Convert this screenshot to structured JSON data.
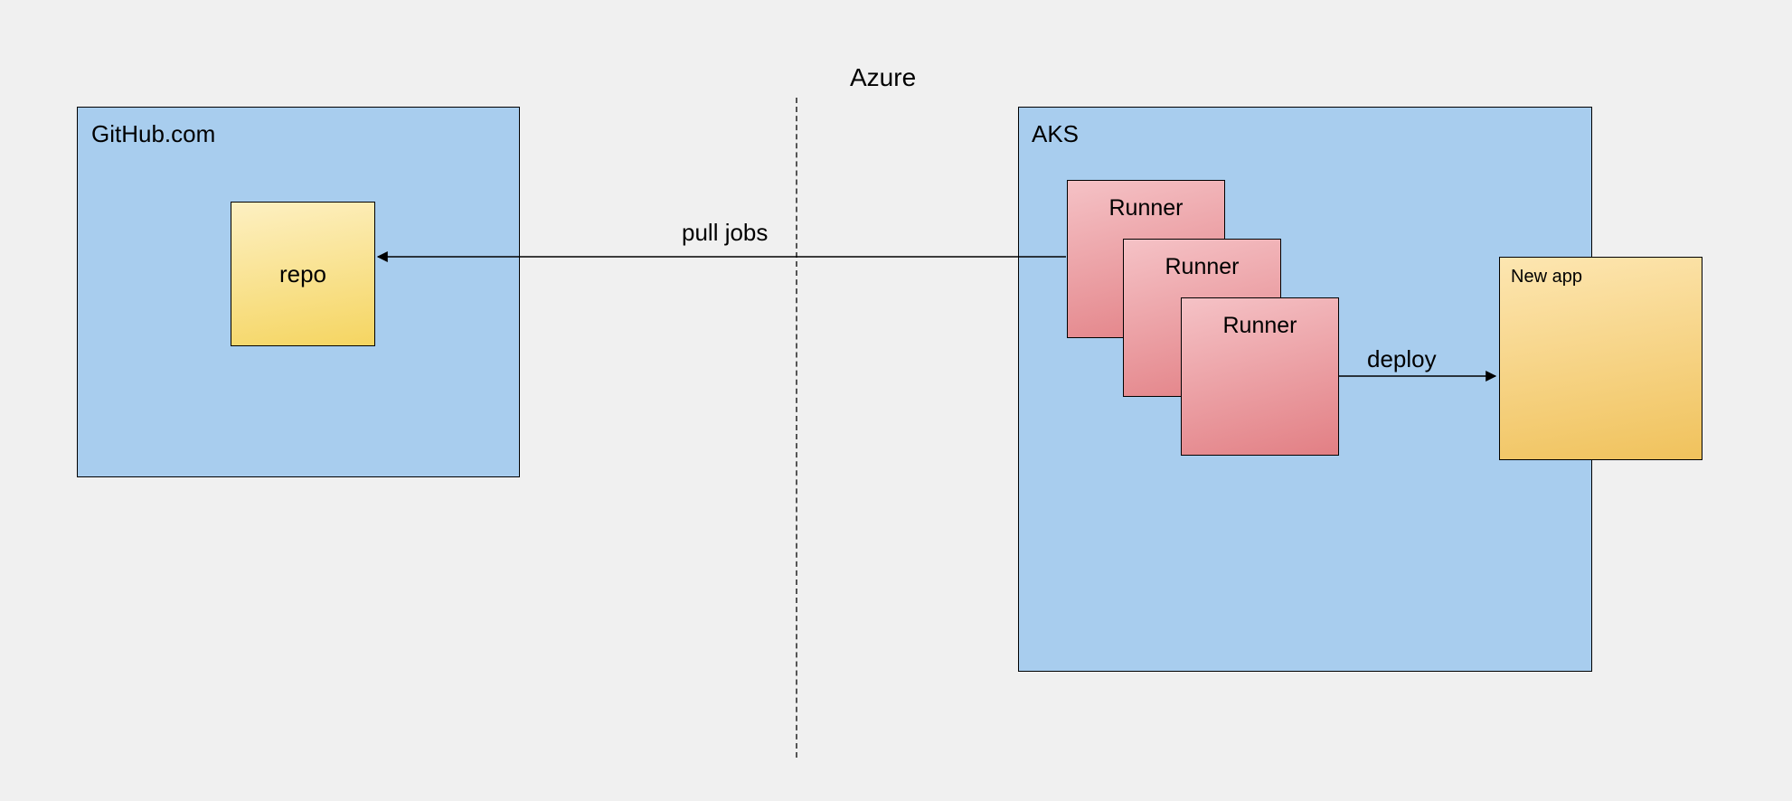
{
  "azure": {
    "label": "Azure"
  },
  "github": {
    "label": "GitHub.com",
    "repo_label": "repo"
  },
  "aks": {
    "label": "AKS",
    "runners": [
      "Runner",
      "Runner",
      "Runner"
    ],
    "newapp_label": "New app"
  },
  "edges": {
    "pull_jobs": "pull jobs",
    "deploy": "deploy"
  },
  "colors": {
    "container_fill": "#a8cdee",
    "repo_gradient_start": "#fdf0c2",
    "repo_gradient_end": "#f5d561",
    "runner_gradient_start": "#f5c2c6",
    "runner_gradient_end": "#e27f84",
    "newapp_gradient_start": "#fde6b1",
    "newapp_gradient_end": "#f0c25c",
    "background": "#f0f0f0"
  },
  "chart_data": {
    "type": "diagram",
    "nodes": [
      {
        "id": "github",
        "label": "GitHub.com",
        "type": "container"
      },
      {
        "id": "repo",
        "label": "repo",
        "type": "box",
        "parent": "github"
      },
      {
        "id": "azure",
        "label": "Azure",
        "type": "region-label"
      },
      {
        "id": "aks",
        "label": "AKS",
        "type": "container"
      },
      {
        "id": "runner1",
        "label": "Runner",
        "type": "box",
        "parent": "aks"
      },
      {
        "id": "runner2",
        "label": "Runner",
        "type": "box",
        "parent": "aks"
      },
      {
        "id": "runner3",
        "label": "Runner",
        "type": "box",
        "parent": "aks"
      },
      {
        "id": "newapp",
        "label": "New app",
        "type": "box",
        "parent": "aks"
      }
    ],
    "edges": [
      {
        "from": "runner1",
        "to": "repo",
        "label": "pull jobs"
      },
      {
        "from": "runner3",
        "to": "newapp",
        "label": "deploy"
      }
    ],
    "divider": {
      "label": "Azure",
      "style": "dashed-vertical"
    }
  }
}
